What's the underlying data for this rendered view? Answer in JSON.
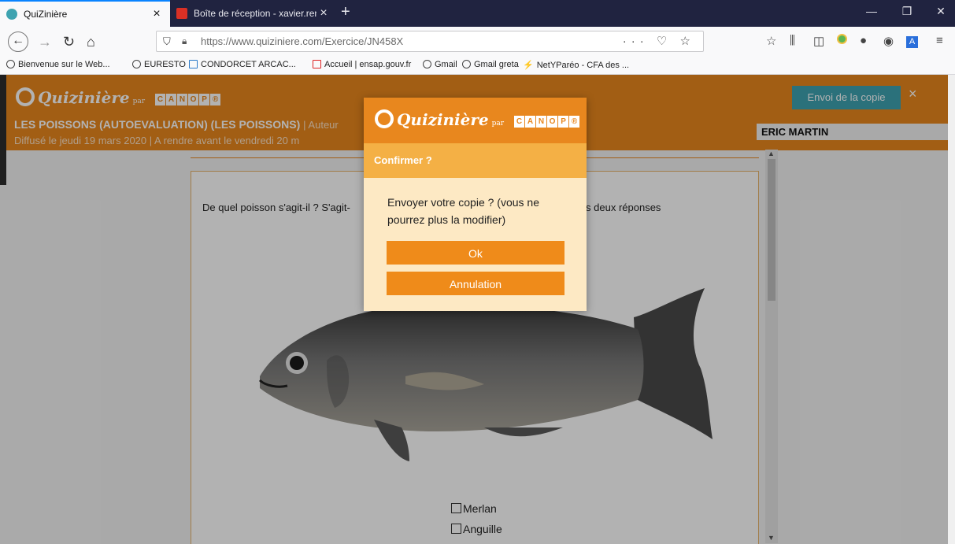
{
  "browser": {
    "tabs": [
      {
        "title": "QuiZinière",
        "close": "×"
      },
      {
        "title": "Boîte de réception - xavier.rena",
        "close": "×"
      }
    ],
    "new_tab": "+",
    "window_controls": [
      "—",
      "❐",
      "✕"
    ],
    "url": "https://www.quiziniere.com/Exercice/JN458X",
    "url_actions": "··· ♡ ☆",
    "bookmarks": [
      "Bienvenue sur le Web...",
      "EURESTO",
      "CONDORCET ARCAC...",
      "Accueil | ensap.gouv.fr",
      "Gmail",
      "Gmail greta",
      "NetYParéo - CFA des ..."
    ]
  },
  "header": {
    "logo_text": "Quizinière",
    "logo_par": "par",
    "canope_letters": [
      "C",
      "A",
      "N",
      "O",
      "P",
      "®"
    ],
    "title": "LES POISSONS (AUTOEVALUATION) (LES POISSONS)",
    "title_suffix": "| Auteur",
    "meta": "Diffusé le  jeudi 19 mars 2020  | A rendre avant le  vendredi 20 m",
    "send_button": "Envoi de la copie",
    "close": "×",
    "student_name": "ERIC MARTIN"
  },
  "question": {
    "text_left": "De quel poisson s'agit-il ? S'agit-",
    "text_right": "es deux réponses",
    "choices": [
      "Merlan",
      "Anguille"
    ]
  },
  "modal": {
    "logo_text": "Quizinière",
    "logo_par": "par",
    "canope_letters": [
      "C",
      "A",
      "N",
      "O",
      "P",
      "®"
    ],
    "title": "Confirmer ?",
    "message": "Envoyer votre copie ? (vous ne pourrez plus la modifier)",
    "ok_label": "Ok",
    "cancel_label": "Annulation"
  },
  "colors": {
    "accent_orange": "#e8871e",
    "modal_bar": "#f4b045",
    "modal_bg": "#fde9c4",
    "send_button": "#3ea3b0"
  }
}
